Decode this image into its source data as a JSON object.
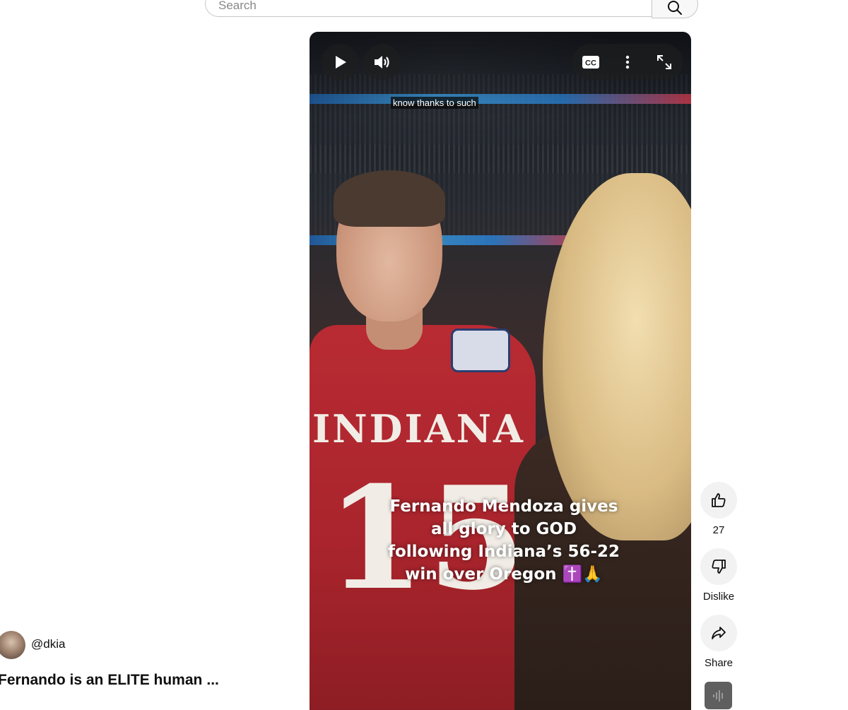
{
  "search": {
    "placeholder": "Search"
  },
  "player": {
    "caption": "know thanks to such",
    "overlay_lines": [
      "Fernando Mendoza gives",
      "all glory to GOD",
      "following Indiana’s 56-22",
      "win over Oregon ✝️🙏"
    ],
    "jersey_text": "INDIANA",
    "jersey_number": "15",
    "controls": {
      "play_icon": "play-icon",
      "volume_icon": "volume-icon",
      "captions_icon": "cc-icon",
      "captions_label": "CC",
      "more_icon": "more-vert-icon",
      "fullscreen_icon": "fullscreen-icon"
    }
  },
  "actions": {
    "like_count": "27",
    "dislike_label": "Dislike",
    "share_label": "Share"
  },
  "channel": {
    "handle": "@dkia"
  },
  "video": {
    "title": "Fernando is an ELITE human",
    "more": "..."
  },
  "colors": {
    "accent_red": "#b92b33",
    "action_bg": "#f2f2f2",
    "control_bg": "#1e1e1e"
  }
}
